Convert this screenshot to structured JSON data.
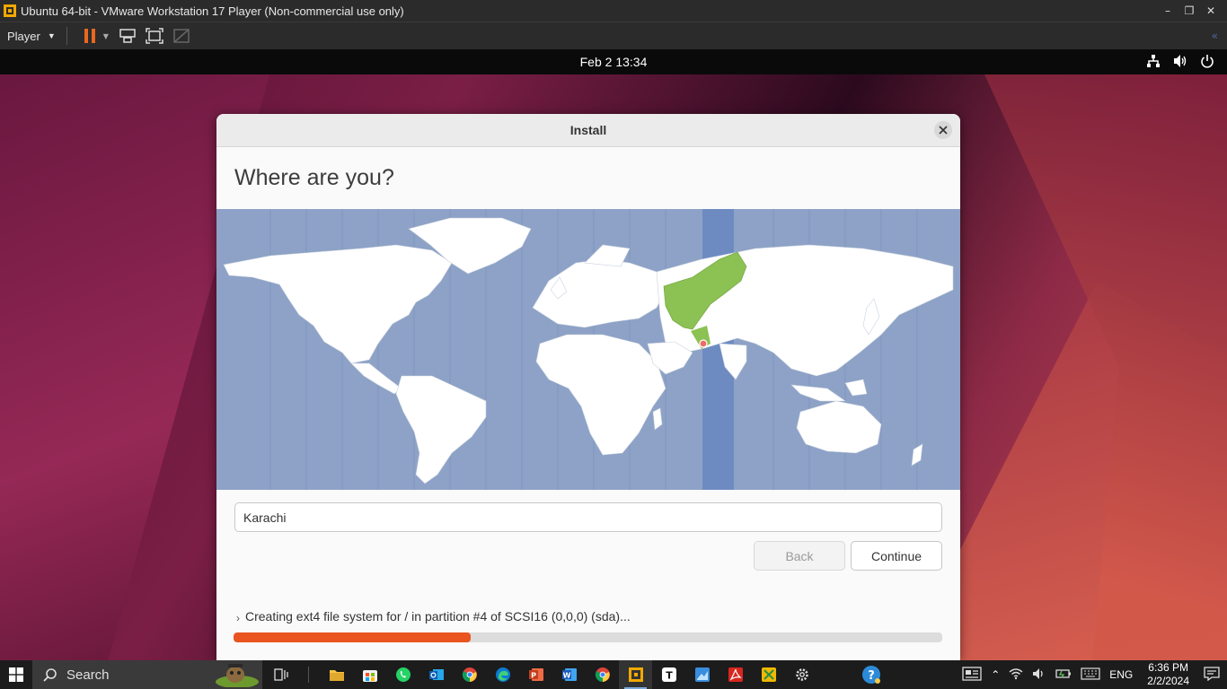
{
  "vm": {
    "title": "Ubuntu 64-bit - VMware Workstation 17 Player (Non-commercial use only)",
    "player_menu": "Player",
    "icons": [
      "pause-icon",
      "send-ctrl-alt-del-icon",
      "fullscreen-icon",
      "unity-icon"
    ]
  },
  "ubuntu": {
    "clock": "Feb 2  13:34",
    "tray_icons": [
      "network-icon",
      "volume-icon",
      "power-icon"
    ]
  },
  "installer": {
    "window_title": "Install",
    "heading": "Where are you?",
    "timezone_value": "Karachi",
    "back_label": "Back",
    "continue_label": "Continue",
    "status_text": "Creating ext4 file system for / in partition #4 of SCSI16 (0,0,0) (sda)...",
    "progress_fraction": 0.335,
    "map": {
      "highlight_color": "#8cc153",
      "timezone_band_color": "#6d8bc1",
      "ocean_color": "#8da2c6"
    }
  },
  "taskbar": {
    "search_label": "Search",
    "language": "ENG",
    "time": "6:36 PM",
    "date": "2/2/2024",
    "apps": [
      "task-view-icon",
      "file-explorer-icon",
      "microsoft-store-icon",
      "whatsapp-icon",
      "outlook-icon",
      "chrome-icon",
      "edge-icon",
      "powerpoint-icon",
      "word-icon",
      "chrome-profile-icon",
      "vmware-icon",
      "typora-icon",
      "paint-icon",
      "acrobat-icon",
      "snip-icon",
      "settings-icon"
    ]
  },
  "colors": {
    "ubuntu_orange": "#e95420",
    "taskbar_bg": "#1c1c1c"
  }
}
